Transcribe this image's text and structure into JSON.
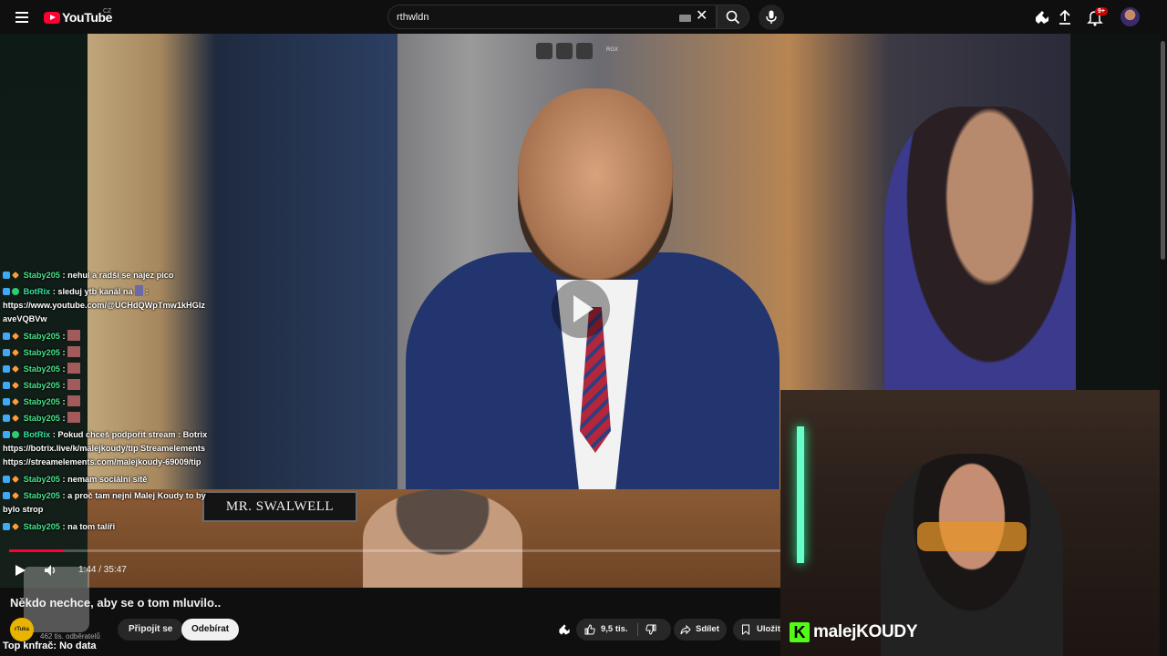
{
  "header": {
    "logo_text": "YouTube",
    "country_code": "CZ",
    "search_value": "rthwldn",
    "notification_count": "9+"
  },
  "video": {
    "overlay_tag": "RGX",
    "nameplate": "MR. SWALWELL",
    "current_time": "1:44",
    "duration": "35:47",
    "time_display": "1:44 / 35:47",
    "progress_fraction": 0.048,
    "title": "Někdo nechce, aby se o tom mluvilo.."
  },
  "chat": {
    "messages": [
      {
        "user": "Staby205",
        "text": ": nehul a radši se najez pico"
      },
      {
        "user": "BotRix",
        "text": ": sleduj ytb kanál na",
        "extra": "https://www.youtube.com/@UCHdQWpTmw1kHGIz aveVQBVw"
      },
      {
        "user": "Staby205",
        "text": ":"
      },
      {
        "user": "Staby205",
        "text": ":"
      },
      {
        "user": "Staby205",
        "text": ":"
      },
      {
        "user": "Staby205",
        "text": ":"
      },
      {
        "user": "Staby205",
        "text": ":"
      },
      {
        "user": "Staby205",
        "text": ":"
      },
      {
        "user": "BotRix",
        "text": ": Pokud chceš podpořit stream : Botrix",
        "extra": "https://botrix.live/k/malejkoudy/tip Streamelements https://streamelements.com/malejkoudy-69009/tip"
      },
      {
        "user": "Staby205",
        "text": ": nemam sociální sítě"
      },
      {
        "user": "Staby205",
        "text": ": a proč tam nejni Malej Koudy to by bylo strop"
      },
      {
        "user": "Staby205",
        "text": ": na tom talíři"
      }
    ]
  },
  "webcam": {
    "logo_letter": "K",
    "name_prefix": "malej",
    "name_suffix": "KOUDY"
  },
  "channel": {
    "avatar_text": "rTuka",
    "name": "",
    "subscribers": "462 tis. odběratelů",
    "join_label": "Připojit se",
    "subscribe_label": "Odebírat"
  },
  "actions": {
    "likes": "9,5 tis.",
    "share_label": "Sdílet",
    "save_label": "Uložit"
  },
  "stream_overlay": {
    "top_donor": "Top knfrač: No data"
  },
  "colors": {
    "brand_red": "#ff0033",
    "background": "#0f0f0f",
    "kick_green": "#53fc18"
  }
}
